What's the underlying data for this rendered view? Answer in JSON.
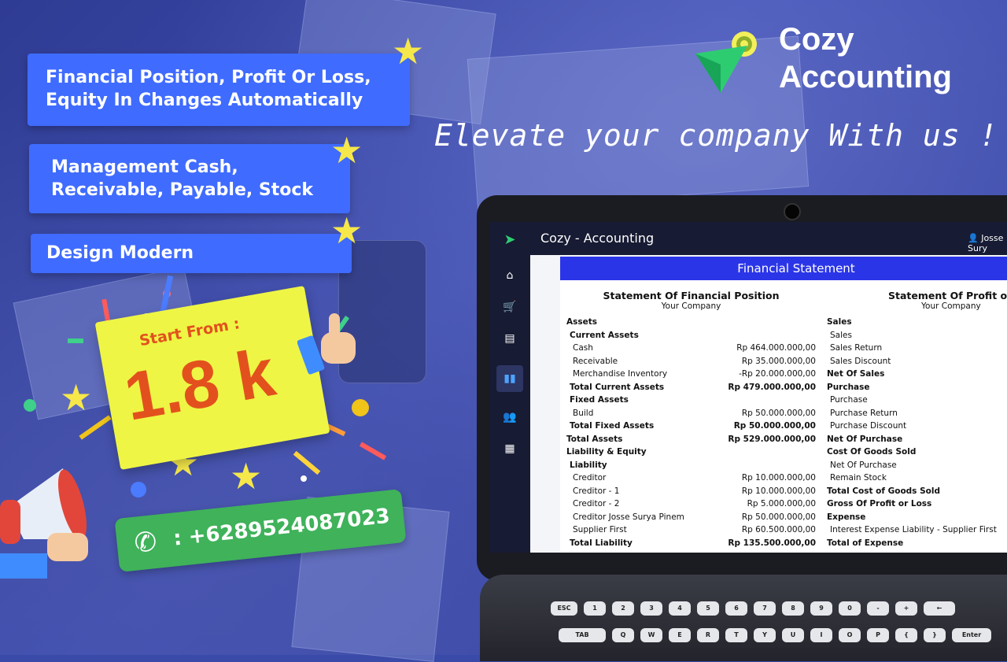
{
  "features": [
    {
      "lines": [
        "Financial Position, Profit Or Loss,",
        "Equity In Changes Automatically"
      ]
    },
    {
      "lines": [
        "Management Cash,",
        "Receivable, Payable, Stock"
      ]
    },
    {
      "lines": [
        "Design Modern"
      ]
    }
  ],
  "brand": {
    "line1": "Cozy",
    "line2": "Accounting",
    "tagline": "Elevate your company With us !"
  },
  "promo": {
    "label": "Start From :",
    "price": "1.8 k"
  },
  "contact": {
    "phone": ": +6289524087023"
  },
  "app": {
    "title": "Cozy - Accounting",
    "user": "Josse Sury",
    "sidebar_icons": [
      "logo-icon",
      "home-icon",
      "cart-icon",
      "document-add-icon",
      "chart-icon",
      "users-icon",
      "building-icon"
    ],
    "statement_header": "Financial Statement",
    "position": {
      "title": "Statement Of Financial Position",
      "company": "Your Company",
      "rows": [
        {
          "label": "Assets",
          "value": "",
          "style": "b"
        },
        {
          "label": "Current Assets",
          "value": "",
          "style": "b i1"
        },
        {
          "label": "Cash",
          "value": "Rp 464.000.000,00",
          "style": "i2"
        },
        {
          "label": "Receivable",
          "value": "Rp 35.000.000,00",
          "style": "i2"
        },
        {
          "label": "Merchandise Inventory",
          "value": "-Rp 20.000.000,00",
          "style": "i2"
        },
        {
          "label": "Total Current Assets",
          "value": "Rp 479.000.000,00",
          "style": "b i1"
        },
        {
          "label": "Fixed Assets",
          "value": "",
          "style": "b i1"
        },
        {
          "label": "Build",
          "value": "Rp 50.000.000,00",
          "style": "i2"
        },
        {
          "label": "Total Fixed Assets",
          "value": "Rp 50.000.000,00",
          "style": "b i1"
        },
        {
          "label": "Total Assets",
          "value": "Rp 529.000.000,00",
          "style": "b"
        },
        {
          "label": "Liability & Equity",
          "value": "",
          "style": "b"
        },
        {
          "label": "Liability",
          "value": "",
          "style": "b i1"
        },
        {
          "label": "Creditor",
          "value": "Rp 10.000.000,00",
          "style": "i2"
        },
        {
          "label": "Creditor - 1",
          "value": "Rp 10.000.000,00",
          "style": "i2"
        },
        {
          "label": "Creditor - 2",
          "value": "Rp 5.000.000,00",
          "style": "i2"
        },
        {
          "label": "Creditor Josse Surya Pinem",
          "value": "Rp 50.000.000,00",
          "style": "i2"
        },
        {
          "label": "Supplier First",
          "value": "Rp 60.500.000,00",
          "style": "i2"
        },
        {
          "label": "Total Liability",
          "value": "Rp 135.500.000,00",
          "style": "b i1"
        }
      ]
    },
    "profit": {
      "title": "Statement Of Profit or Los",
      "company": "Your Company",
      "rows": [
        {
          "label": "Sales",
          "value": "",
          "style": "b"
        },
        {
          "label": "Sales",
          "value": "",
          "style": "i1"
        },
        {
          "label": "Sales Return",
          "value": "",
          "style": "i1"
        },
        {
          "label": "Sales Discount",
          "value": "",
          "style": "i1"
        },
        {
          "label": "Net Of Sales",
          "value": "",
          "style": "b"
        },
        {
          "label": "Purchase",
          "value": "",
          "style": "b"
        },
        {
          "label": "Purchase",
          "value": "",
          "style": "i1"
        },
        {
          "label": "Purchase Return",
          "value": "",
          "style": "i1"
        },
        {
          "label": "Purchase Discount",
          "value": "",
          "style": "i1"
        },
        {
          "label": "Net Of Purchase",
          "value": "",
          "style": "b"
        },
        {
          "label": "Cost Of Goods Sold",
          "value": "",
          "style": "b"
        },
        {
          "label": "Net Of Purchase",
          "value": "",
          "style": "i1"
        },
        {
          "label": "Remain Stock",
          "value": "",
          "style": "i1"
        },
        {
          "label": "Total Cost of Goods Sold",
          "value": "",
          "style": "b"
        },
        {
          "label": "Gross Of Profit or Loss",
          "value": "",
          "style": "b"
        },
        {
          "label": "Expense",
          "value": "",
          "style": "b"
        },
        {
          "label": "Interest Expense Liability - Supplier First",
          "value": "",
          "style": "i1"
        },
        {
          "label": "Total of Expense",
          "value": "",
          "style": "b"
        }
      ]
    }
  },
  "keyboard": {
    "row1": [
      "ESC",
      "1",
      "2",
      "3",
      "4",
      "5",
      "6",
      "7",
      "8",
      "9",
      "0",
      "-",
      "+",
      "←"
    ],
    "row2": [
      "TAB",
      "Q",
      "W",
      "E",
      "R",
      "T",
      "Y",
      "U",
      "I",
      "O",
      "P",
      "{",
      "}",
      "Enter"
    ]
  }
}
